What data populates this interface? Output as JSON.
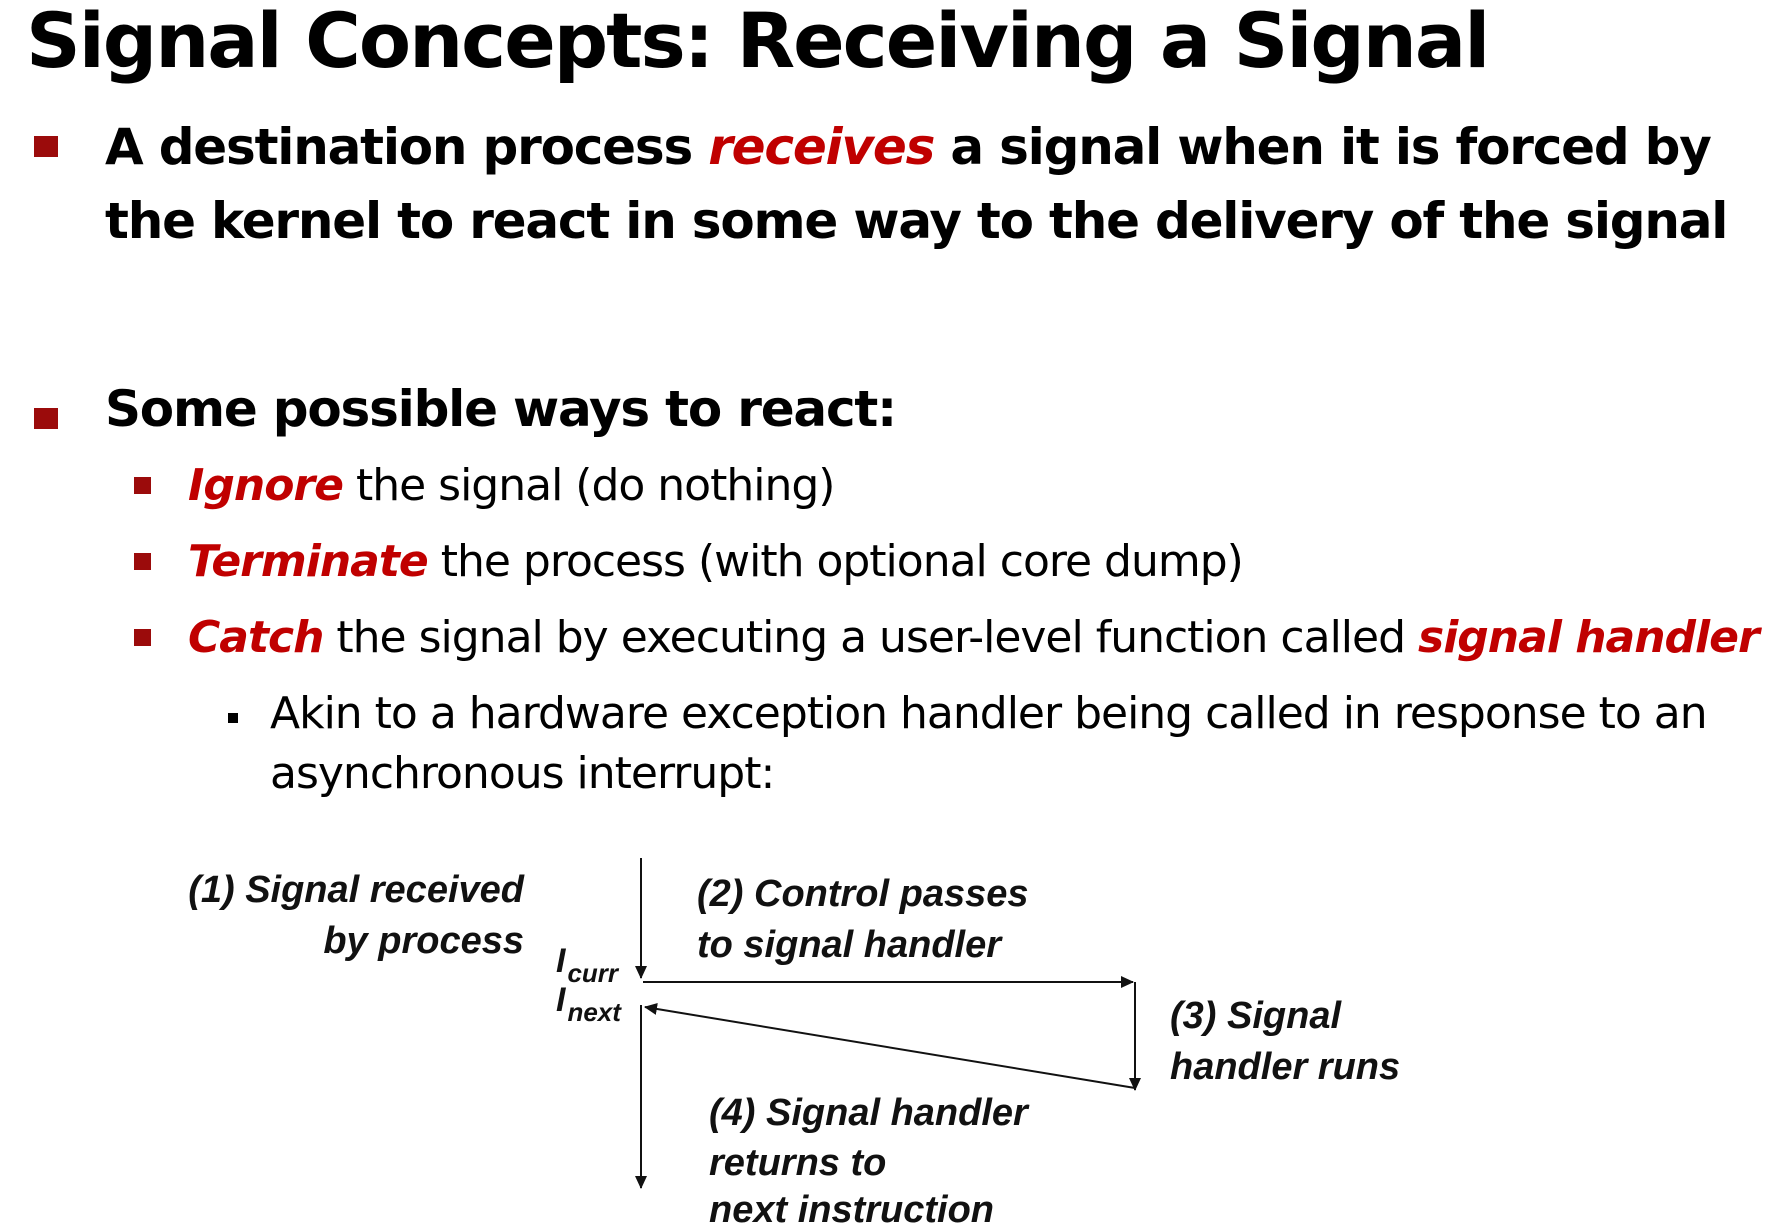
{
  "title": "Signal Concepts: Receiving a Signal",
  "colors": {
    "accent": "#c00000",
    "bullet": "#9b0b0b"
  },
  "bullets": [
    {
      "line1": {
        "before": "A destination process ",
        "em": "receives",
        "after": " a signal when it is forced by"
      },
      "line2": "the kernel to react in some way to the delivery of the signal"
    },
    {
      "text": "Some possible ways to react:",
      "sub": [
        {
          "em": "Ignore",
          "text": " the signal (do nothing)"
        },
        {
          "em": "Terminate",
          "text": " the process (with optional core dump)"
        },
        {
          "em": "Catch",
          "text": " the signal by executing a user-level function called ",
          "em2": "signal handler"
        }
      ],
      "subsub": {
        "line1": "Akin to a hardware exception handler being called in response to an",
        "line2": "asynchronous interrupt:"
      }
    }
  ],
  "diagram": {
    "step1": [
      "(1) Signal received",
      "by process"
    ],
    "step2": [
      "(2) Control passes",
      "to signal handler"
    ],
    "step3": [
      "(3) Signal",
      "handler runs"
    ],
    "step4": [
      "(4) Signal handler",
      "returns to",
      "next instruction"
    ],
    "icurr": {
      "base": "I",
      "sub": "curr"
    },
    "inext": {
      "base": "I",
      "sub": "next"
    }
  }
}
